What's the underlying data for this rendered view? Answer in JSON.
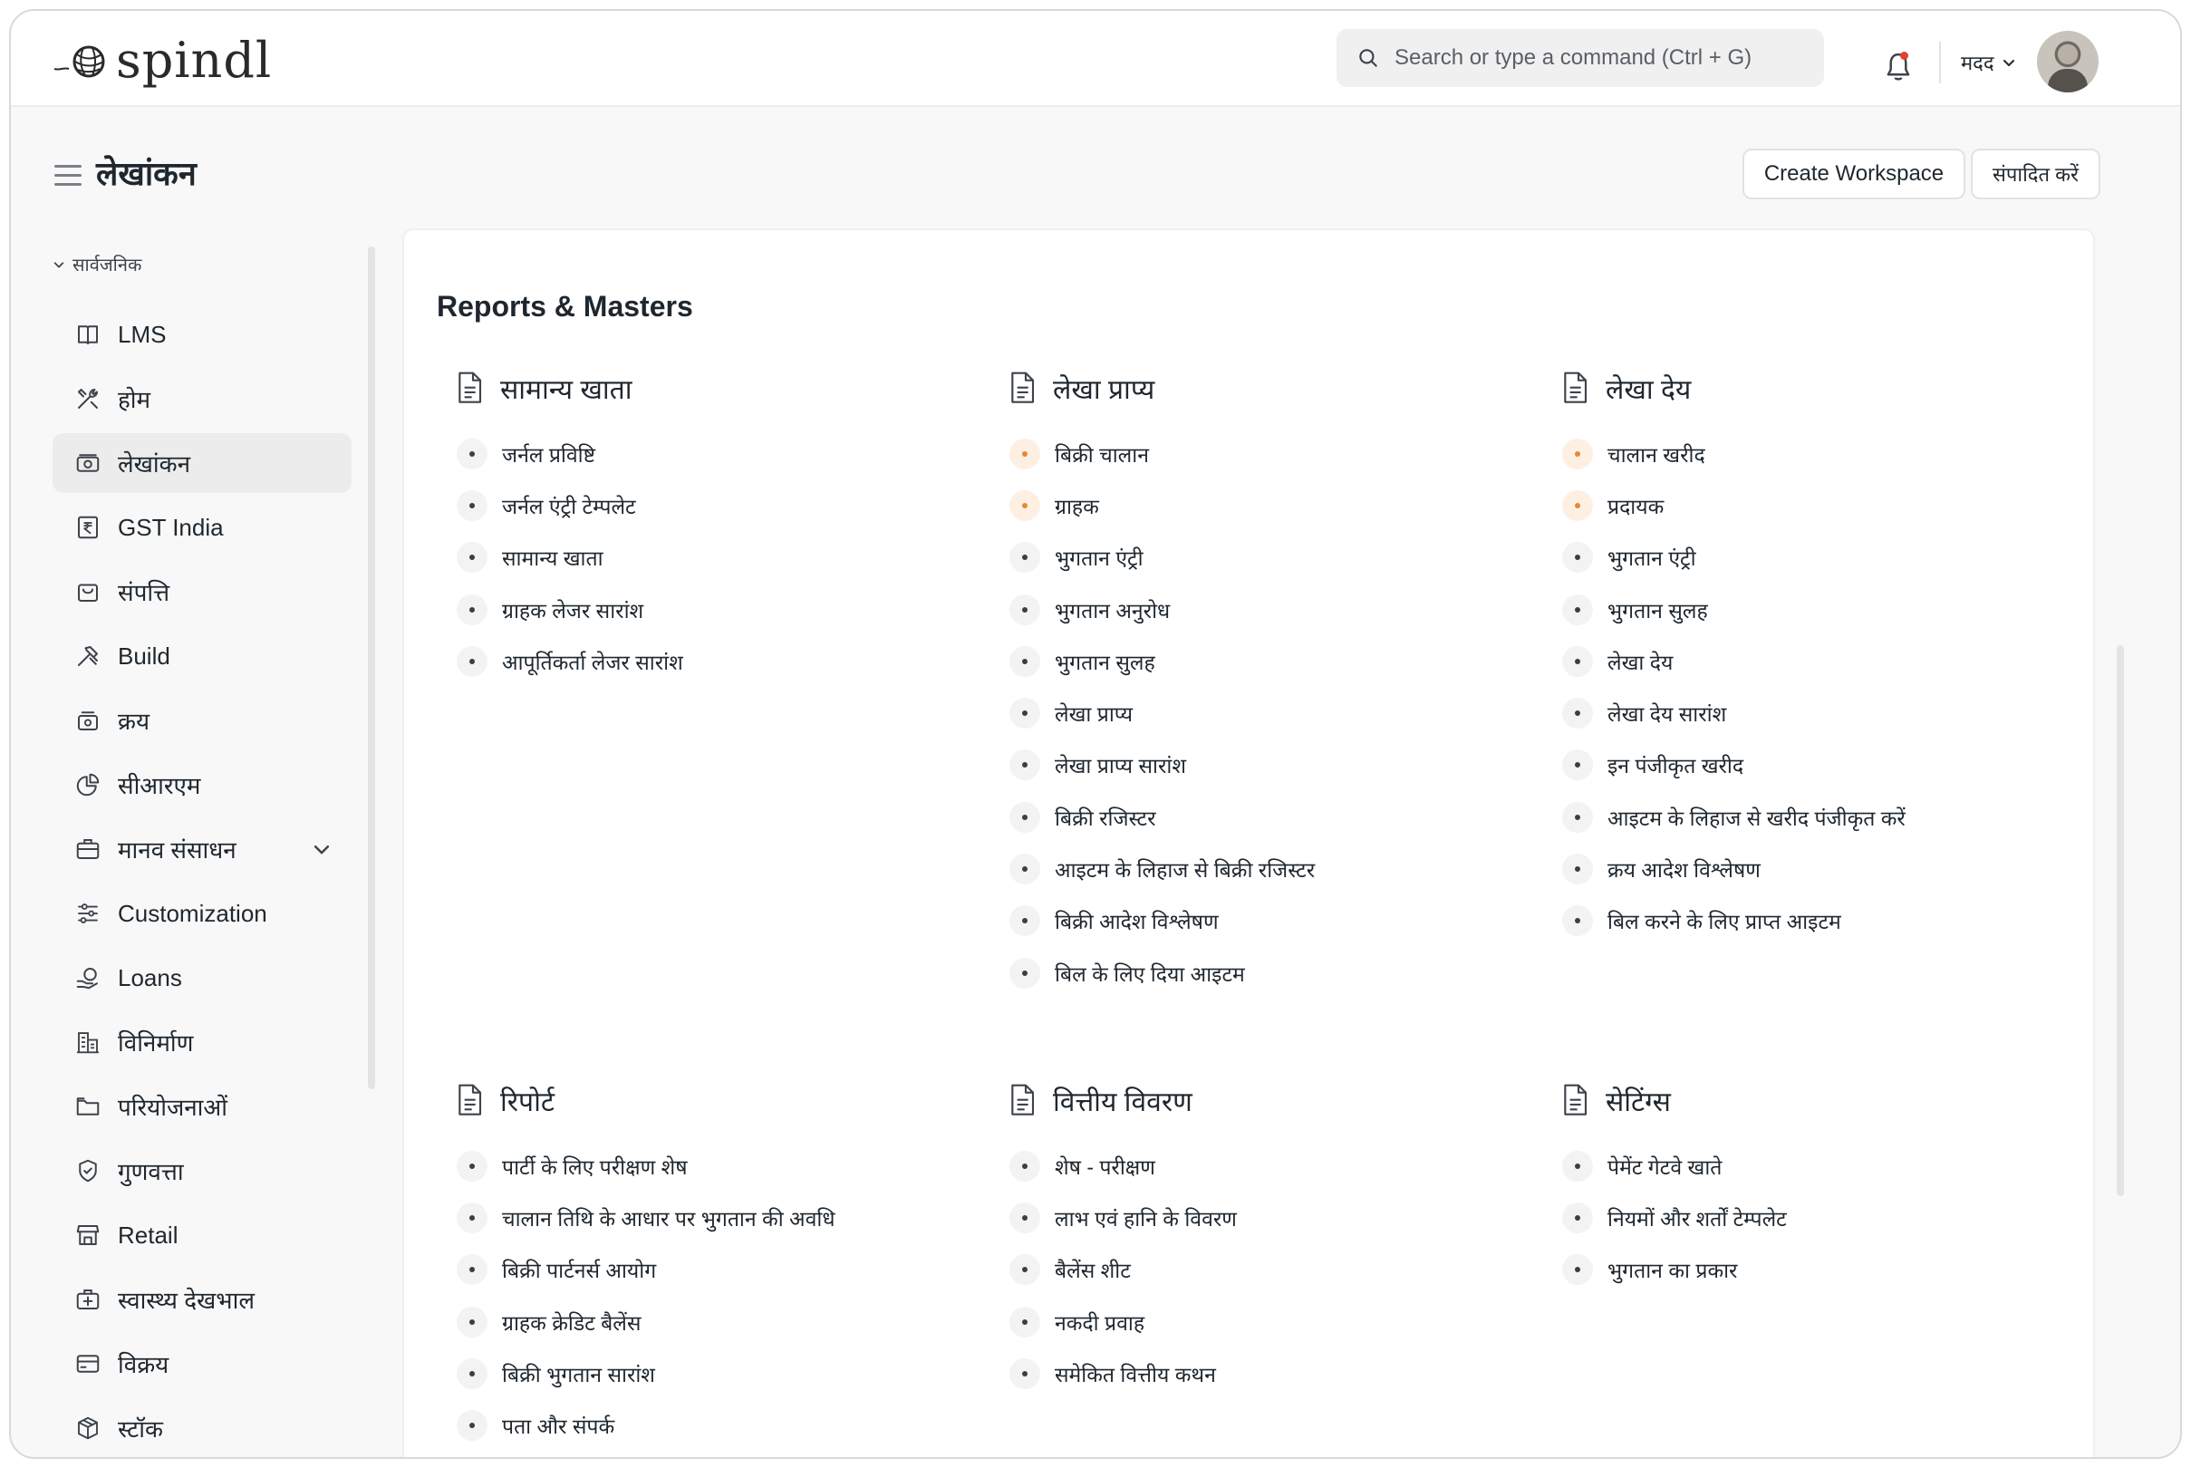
{
  "app": {
    "logo_text": "spindl"
  },
  "navbar": {
    "search_placeholder": "Search or type a command (Ctrl + G)",
    "help_label": "मदद"
  },
  "page": {
    "title": "लेखांकन",
    "create_workspace": "Create Workspace",
    "edit_label": "संपादित करें"
  },
  "sidebar": {
    "section_label": "सार्वजनिक",
    "items": [
      {
        "label": "LMS",
        "icon": "book-icon"
      },
      {
        "label": "होम",
        "icon": "tools-icon"
      },
      {
        "label": "लेखांकन",
        "icon": "money-icon",
        "active": true
      },
      {
        "label": "GST India",
        "icon": "rupee-receipt-icon"
      },
      {
        "label": "संपत्ति",
        "icon": "shopping-bag-icon"
      },
      {
        "label": "Build",
        "icon": "hammer-icon"
      },
      {
        "label": "क्रय",
        "icon": "cash-box-icon"
      },
      {
        "label": "सीआरएम",
        "icon": "pie-chart-icon"
      },
      {
        "label": "मानव संसाधन",
        "icon": "briefcase-icon",
        "expandable": true
      },
      {
        "label": "Customization",
        "icon": "sliders-icon"
      },
      {
        "label": "Loans",
        "icon": "hand-coin-icon"
      },
      {
        "label": "विनिर्माण",
        "icon": "factory-icon"
      },
      {
        "label": "परियोजनाओं",
        "icon": "folder-icon"
      },
      {
        "label": "गुणवत्ता",
        "icon": "badge-check-icon"
      },
      {
        "label": "Retail",
        "icon": "storefront-icon"
      },
      {
        "label": "स्वास्थ्य देखभाल",
        "icon": "medical-kit-icon"
      },
      {
        "label": "विक्रय",
        "icon": "card-icon"
      },
      {
        "label": "स्टॉक",
        "icon": "box-icon"
      }
    ]
  },
  "main": {
    "title": "Reports & Masters",
    "groups": [
      {
        "title": "सामान्य खाता",
        "items": [
          {
            "label": "जर्नल प्रविष्टि",
            "accent": false
          },
          {
            "label": "जर्नल एंट्री टेम्पलेट",
            "accent": false
          },
          {
            "label": "सामान्य खाता",
            "accent": false
          },
          {
            "label": "ग्राहक लेजर सारांश",
            "accent": false
          },
          {
            "label": "आपूर्तिकर्ता लेजर सारांश",
            "accent": false
          }
        ]
      },
      {
        "title": "लेखा प्राप्य",
        "items": [
          {
            "label": "बिक्री चालान",
            "accent": true
          },
          {
            "label": "ग्राहक",
            "accent": true
          },
          {
            "label": "भुगतान एंट्री",
            "accent": false
          },
          {
            "label": "भुगतान अनुरोध",
            "accent": false
          },
          {
            "label": "भुगतान सुलह",
            "accent": false
          },
          {
            "label": "लेखा प्राप्य",
            "accent": false
          },
          {
            "label": "लेखा प्राप्य सारांश",
            "accent": false
          },
          {
            "label": "बिक्री रजिस्टर",
            "accent": false
          },
          {
            "label": "आइटम के लिहाज से बिक्री रजिस्टर",
            "accent": false
          },
          {
            "label": "बिक्री आदेश विश्लेषण",
            "accent": false
          },
          {
            "label": "बिल के लिए दिया आइटम",
            "accent": false
          }
        ]
      },
      {
        "title": "लेखा देय",
        "items": [
          {
            "label": "चालान खरीद",
            "accent": true
          },
          {
            "label": "प्रदायक",
            "accent": true
          },
          {
            "label": "भुगतान एंट्री",
            "accent": false
          },
          {
            "label": "भुगतान सुलह",
            "accent": false
          },
          {
            "label": "लेखा देय",
            "accent": false
          },
          {
            "label": "लेखा देय सारांश",
            "accent": false
          },
          {
            "label": "इन पंजीकृत खरीद",
            "accent": false
          },
          {
            "label": "आइटम के लिहाज से खरीद पंजीकृत करें",
            "accent": false
          },
          {
            "label": "क्रय आदेश विश्लेषण",
            "accent": false
          },
          {
            "label": "बिल करने के लिए प्राप्त आइटम",
            "accent": false
          }
        ]
      },
      {
        "title": "रिपोर्ट",
        "items": [
          {
            "label": "पार्टी के लिए परीक्षण शेष",
            "accent": false
          },
          {
            "label": "चालान तिथि के आधार पर भुगतान की अवधि",
            "accent": false
          },
          {
            "label": "बिक्री पार्टनर्स आयोग",
            "accent": false
          },
          {
            "label": "ग्राहक क्रेडिट बैलेंस",
            "accent": false
          },
          {
            "label": "बिक्री भुगतान सारांश",
            "accent": false
          },
          {
            "label": "पता और संपर्क",
            "accent": false
          }
        ]
      },
      {
        "title": "वित्तीय विवरण",
        "items": [
          {
            "label": "शेष - परीक्षण",
            "accent": false
          },
          {
            "label": "लाभ एवं हानि के विवरण",
            "accent": false
          },
          {
            "label": "बैलेंस शीट",
            "accent": false
          },
          {
            "label": "नकदी प्रवाह",
            "accent": false
          },
          {
            "label": "समेकित वित्तीय कथन",
            "accent": false
          }
        ]
      },
      {
        "title": "सेटिंग्स",
        "items": [
          {
            "label": "पेमेंट गेटवे खाते",
            "accent": false
          },
          {
            "label": "नियमों और शर्तों टेम्पलेट",
            "accent": false
          },
          {
            "label": "भुगतान का प्रकार",
            "accent": false
          }
        ]
      }
    ]
  }
}
